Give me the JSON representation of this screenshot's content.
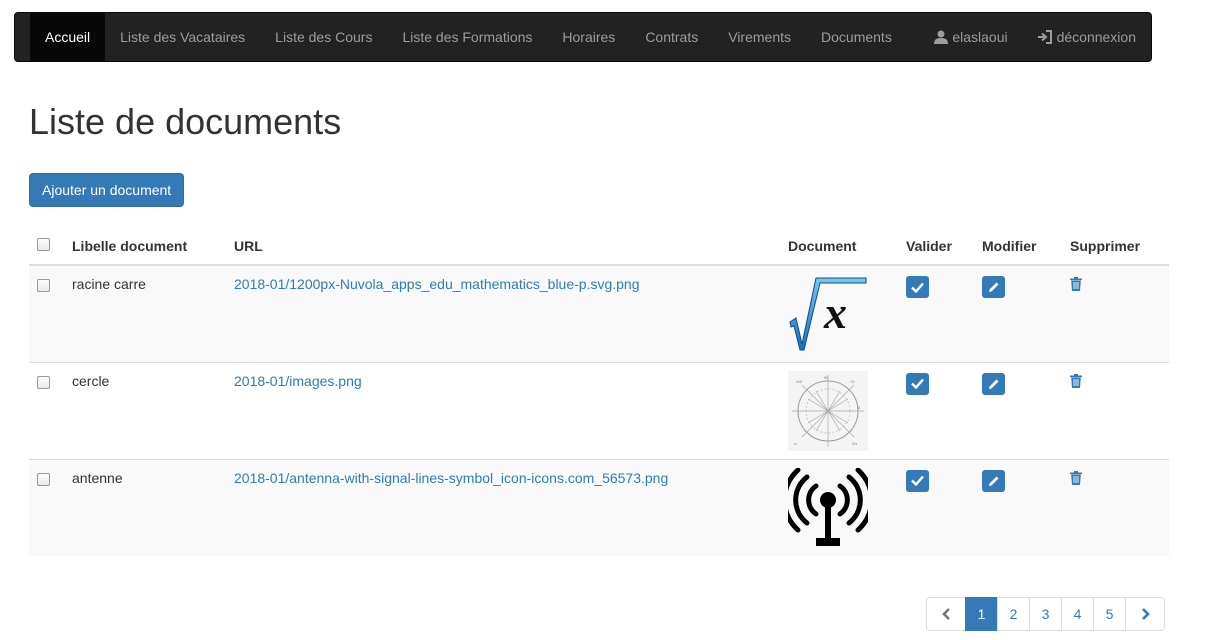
{
  "navbar": {
    "items": [
      "Accueil",
      "Liste des Vacataires",
      "Liste des Cours",
      "Liste des Formations",
      "Horaires",
      "Contrats",
      "Virements",
      "Documents"
    ],
    "user": "elaslaoui",
    "logout": "déconnexion"
  },
  "page": {
    "title": "Liste de documents",
    "add_button": "Ajouter un document"
  },
  "table": {
    "headers": {
      "libelle": "Libelle document",
      "url": "URL",
      "document": "Document",
      "valider": "Valider",
      "modifier": "Modifier",
      "supprimer": "Supprimer"
    },
    "rows": [
      {
        "libelle": "racine carre",
        "url": "2018-01/1200px-Nuvola_apps_edu_mathematics_blue-p.svg.png",
        "thumb": "square-root-x-icon"
      },
      {
        "libelle": "cercle",
        "url": "2018-01/images.png",
        "thumb": "unit-circle-image"
      },
      {
        "libelle": "antenne",
        "url": "2018-01/antenna-with-signal-lines-symbol_icon-icons.com_56573.png",
        "thumb": "antenna-signal-icon"
      }
    ]
  },
  "pagination": {
    "pages": [
      "1",
      "2",
      "3",
      "4",
      "5"
    ],
    "active": "1"
  },
  "colors": {
    "navbar": "#222222",
    "primary": "#337ab7",
    "link": "#337ab7"
  }
}
